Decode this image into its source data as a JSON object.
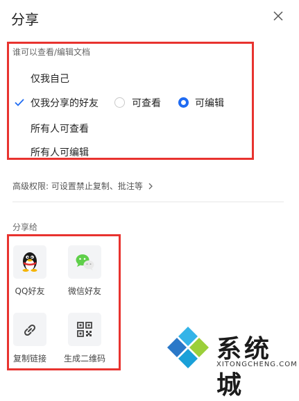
{
  "header": {
    "title": "分享"
  },
  "permissions": {
    "section_label": "谁可以查看/编辑文档",
    "options": [
      {
        "label": "仅我自己"
      },
      {
        "label": "仅我分享的好友",
        "selected": true
      },
      {
        "label": "所有人可查看"
      },
      {
        "label": "所有人可编辑"
      }
    ],
    "friend_access": {
      "view_label": "可查看",
      "edit_label": "可编辑",
      "selected": "edit"
    }
  },
  "advanced": {
    "label": "高级权限: 可设置禁止复制、批注等"
  },
  "share_to": {
    "section_label": "分享给",
    "targets": [
      {
        "label": "QQ好友",
        "icon": "qq-penguin-icon"
      },
      {
        "label": "微信好友",
        "icon": "wechat-icon"
      },
      {
        "label": "复制链接",
        "icon": "link-icon"
      },
      {
        "label": "生成二维码",
        "icon": "qr-code-icon"
      }
    ]
  },
  "watermark": {
    "name": "系统城",
    "url": "XITONGCHENG.COM"
  },
  "colors": {
    "accent": "#1f6bf2",
    "highlight_border": "#e8332f",
    "wechat_green": "#5fcf4a"
  }
}
